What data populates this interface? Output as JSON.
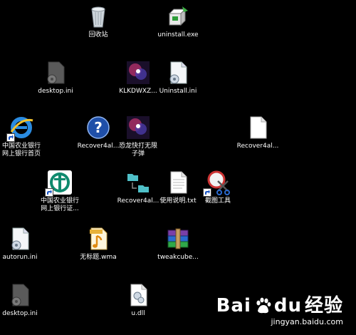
{
  "desktop": {
    "icons": [
      {
        "label": "回收站",
        "icon": "recycle-bin-icon"
      },
      {
        "label": "uninstall.exe",
        "icon": "installer-icon"
      },
      {
        "label": "desktop.ini",
        "icon": "settings-file-icon"
      },
      {
        "label": "KLKDWXZ...",
        "icon": "image-icon"
      },
      {
        "label": "Uninstall.ini",
        "icon": "settings-file-icon"
      },
      {
        "label": "中国农业银行\n网上银行首页",
        "icon": "internet-explorer-icon"
      },
      {
        "label": "Recover4al...",
        "icon": "help-icon"
      },
      {
        "label": "恐龙快打无限\n子弹",
        "icon": "image-icon"
      },
      {
        "label": "Recover4al...",
        "icon": "blank-file-icon"
      },
      {
        "label": "中国农业银行\n网上银行证...",
        "icon": "abc-bank-icon"
      },
      {
        "label": "Recover4al...",
        "icon": "folder-link-icon"
      },
      {
        "label": "使用说明.txt",
        "icon": "text-file-icon"
      },
      {
        "label": "截图工具",
        "icon": "snipping-tool-icon"
      },
      {
        "label": "autorun.ini",
        "icon": "settings-file-icon"
      },
      {
        "label": "无标题.wma",
        "icon": "audio-file-icon"
      },
      {
        "label": "tweakcube...",
        "icon": "archive-icon"
      },
      {
        "label": "desktop.ini",
        "icon": "settings-file-icon"
      },
      {
        "label": "u.dll",
        "icon": "dll-file-icon"
      }
    ]
  },
  "watermark": {
    "brand": "Bai",
    "brand_after": "du",
    "brand_cn": "经验",
    "url": "jingyan.baidu.com"
  },
  "colors": {
    "background": "#000000",
    "label_text": "#ffffff"
  }
}
